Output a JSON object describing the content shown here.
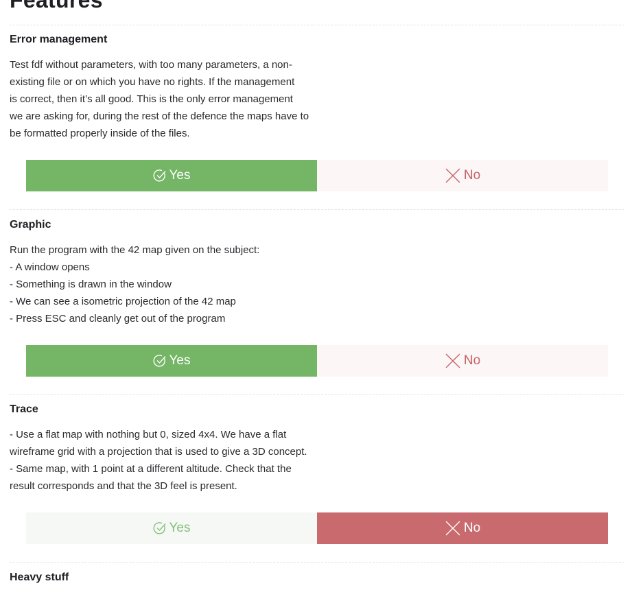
{
  "page": {
    "heading": "Features"
  },
  "sections": [
    {
      "title": "Error management",
      "description": "Test fdf without parameters, with too many parameters, a non-\nexisting file or on which you have no rights. If the management\nis correct, then it’s all good. This is the only error management\nwe are asking for, during the rest of the defence the maps have to\nbe formatted properly inside of the files.",
      "yes_label": "Yes",
      "no_label": "No",
      "selected": "yes"
    },
    {
      "title": "Graphic",
      "description": "Run the program with the 42 map given on the subject:\n- A window opens\n- Something is drawn in the window\n- We can see a isometric projection of the 42 map\n- Press ESC and cleanly get out of the program",
      "yes_label": "Yes",
      "no_label": "No",
      "selected": "yes"
    },
    {
      "title": "Trace",
      "description": "- Use a flat map with nothing but 0, sized 4x4. We have a flat\nwireframe grid with a projection that is used to give a 3D concept.\n- Same map, with 1 point at a different altitude. Check that the\nresult corresponds and that the 3D feel is present.",
      "yes_label": "Yes",
      "no_label": "No",
      "selected": "no"
    },
    {
      "title": "Heavy stuff"
    }
  ],
  "colors": {
    "yes_active": "#74b566",
    "no_active": "#c86a6e",
    "yes_idle_text": "#82c07a",
    "no_idle_text": "#c56468"
  },
  "icons": {
    "yes": "check-circle-icon",
    "no": "x-cross-icon"
  }
}
